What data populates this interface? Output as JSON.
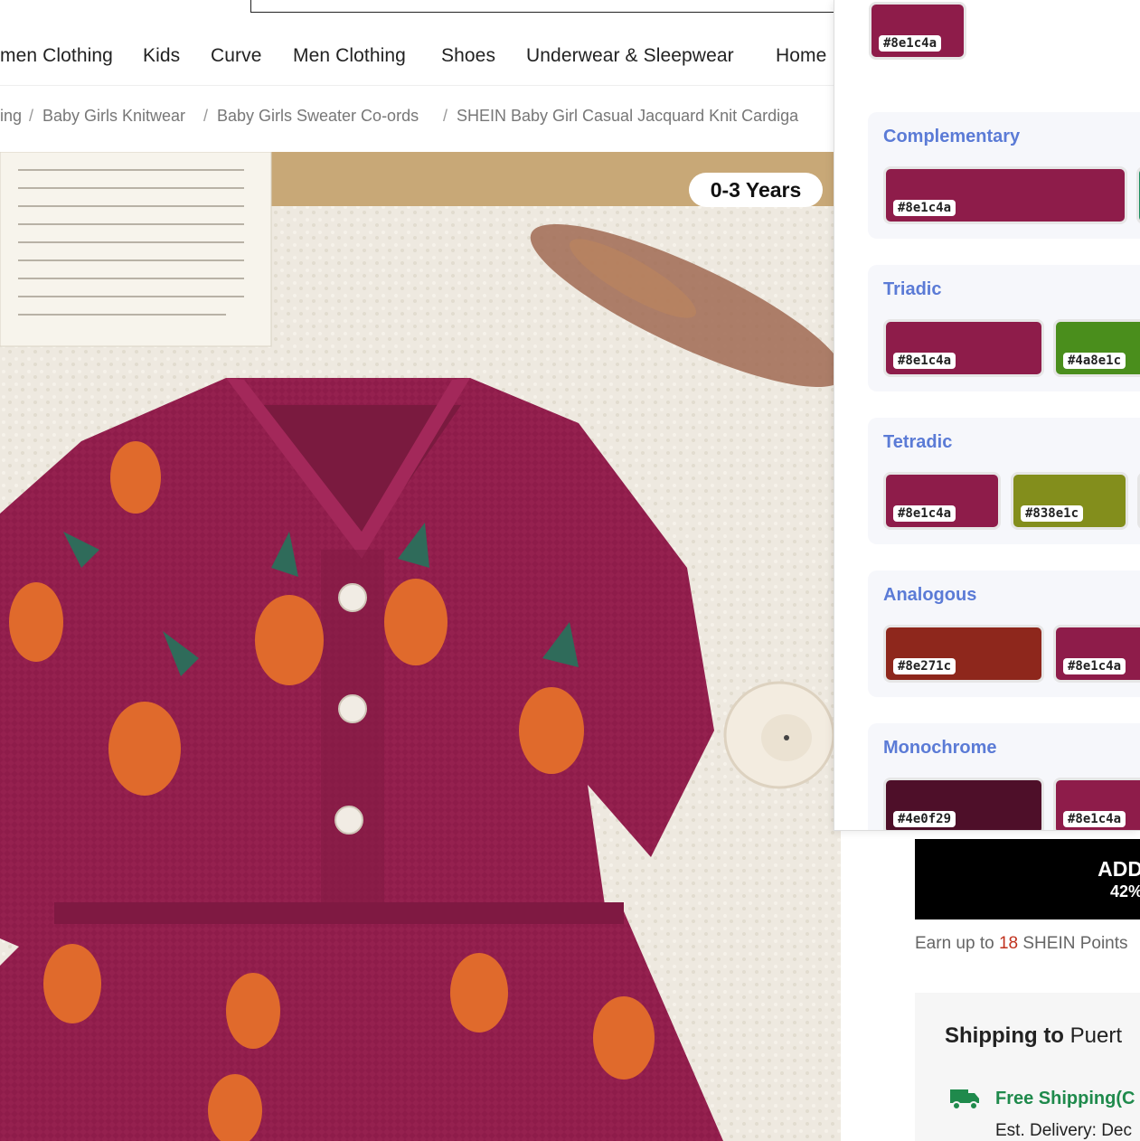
{
  "nav": {
    "items": [
      "men Clothing",
      "Kids",
      "Curve",
      "Men Clothing",
      "Shoes",
      "Underwear & Sleepwear",
      "Home"
    ]
  },
  "breadcrumb": {
    "items": [
      "ing",
      "Baby Girls Knitwear",
      "Baby Girls Sweater Co-ords",
      "SHEIN Baby Girl Casual Jacquard Knit Cardiga"
    ],
    "separator": "/"
  },
  "product": {
    "age_badge": "0-3 Years",
    "add_button_label": "ADD",
    "add_button_sub": "42%",
    "points_prefix": "Earn up to",
    "points_value": "18",
    "points_suffix": "SHEIN Points",
    "shipping_label": "Shipping to",
    "shipping_dest": "Puert",
    "free_shipping": "Free Shipping(C",
    "est_delivery": "Est. Delivery: Dec"
  },
  "palette": {
    "base": {
      "hex": "#8e1c4a"
    },
    "sections": [
      {
        "title": "Complementary",
        "swatches": [
          {
            "hex": "#8e1c4a"
          }
        ]
      },
      {
        "title": "Triadic",
        "swatches": [
          {
            "hex": "#8e1c4a"
          },
          {
            "hex": "#4a8e1c"
          }
        ]
      },
      {
        "title": "Tetradic",
        "swatches": [
          {
            "hex": "#8e1c4a"
          },
          {
            "hex": "#838e1c"
          }
        ]
      },
      {
        "title": "Analogous",
        "swatches": [
          {
            "hex": "#8e271c"
          },
          {
            "hex": "#8e1c4a"
          }
        ]
      },
      {
        "title": "Monochrome",
        "swatches": [
          {
            "hex": "#4e0f29"
          },
          {
            "hex": "#8e1c4a"
          }
        ]
      }
    ]
  },
  "colors": {
    "accent_title": "#5b7bd6",
    "points_highlight": "#c0311d",
    "free_shipping": "#1f8a4c",
    "sweater": "#8e1c4a"
  },
  "icons": [
    "truck-icon",
    "button-icon"
  ]
}
